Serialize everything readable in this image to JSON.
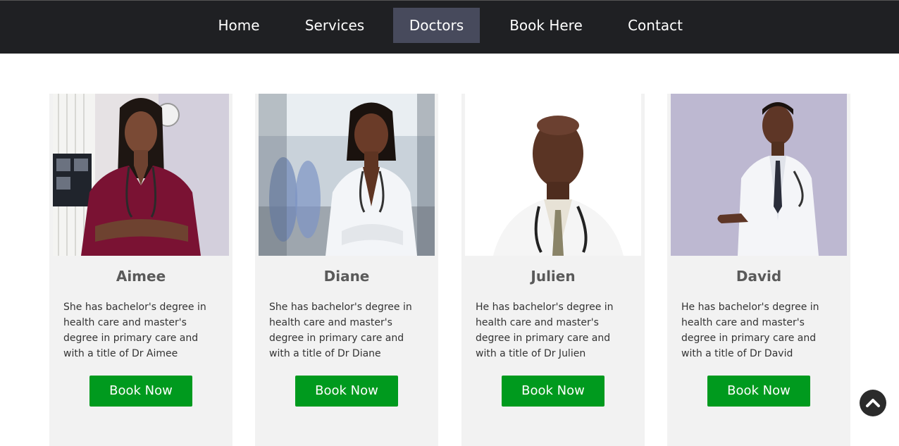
{
  "nav": {
    "items": [
      {
        "label": "Home"
      },
      {
        "label": "Services"
      },
      {
        "label": "Doctors",
        "active": true
      },
      {
        "label": "Book Here"
      },
      {
        "label": "Contact"
      }
    ]
  },
  "doctors": [
    {
      "name": "Aimee",
      "description": "She has bachelor's degree in health care and master's degree in primary care and with a title of Dr Aimee",
      "button_label": "Book Now"
    },
    {
      "name": "Diane",
      "description": "She has bachelor's degree in health care and master's degree in primary care and with a title of Dr Diane",
      "button_label": "Book Now"
    },
    {
      "name": "Julien",
      "description": "He has bachelor's degree in health care and master's degree in primary care and with a title of Dr Julien",
      "button_label": "Book Now"
    },
    {
      "name": "David",
      "description": "He has bachelor's degree in health care and master's degree in primary care and with a title of Dr David",
      "button_label": "Book Now"
    }
  ],
  "colors": {
    "nav_bg": "#1f2023",
    "nav_active": "#474a5c",
    "card_bg": "#f2f2f2",
    "button_green": "#009a1e"
  },
  "icons": {
    "scroll_top": "chevron-up-icon"
  }
}
